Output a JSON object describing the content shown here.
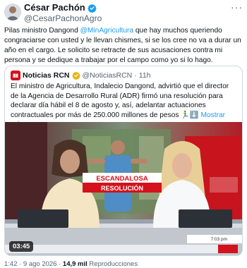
{
  "tweet": {
    "author_name": "César Pachón",
    "author_handle": "@CesarPachonAgro",
    "more_label": "···",
    "text_before": "Pilas ministro Dangond ",
    "mention": "@MinAgricultura",
    "text_after": " que hay muchos queriendo congraciarse con usted y le llevan chismes, si se los cree no va a durar un año en el cargo. Le solicito se retracte de sus acusaciones contra mi persona y se dedique a trabajar por el campo como yo si lo hago."
  },
  "quote": {
    "name": "Noticias RCN",
    "handle": "@NoticiasRCN",
    "separator": "·",
    "time": "11h",
    "text": "El ministro de Agricultura, Indalecio Dangond, advirtió que el director de la Agencia de Desarrollo Rural (ADR) firmó una resolución para declarar día hábil el 8 de agosto y, así, adelantar actuaciones contractuales por más de 250.000 millones de pesos 🏃‍♂️⬇️",
    "show_more": "Mostrar más",
    "video": {
      "banner_line1": "ESCANDALOSA",
      "banner_line2": "RESOLUCIÓN",
      "clock": "7:03 pm",
      "duration": "03:45"
    }
  },
  "footer": {
    "time": "1:42 · 9 ago 2026 · ",
    "views": "14,9 mil",
    "views_label": " Reproducciones"
  },
  "colors": {
    "verified_blue": "#1d9bf0",
    "verified_gold": "#e2b719",
    "rcn_red": "#d3121b",
    "link": "#1d9bf0"
  }
}
